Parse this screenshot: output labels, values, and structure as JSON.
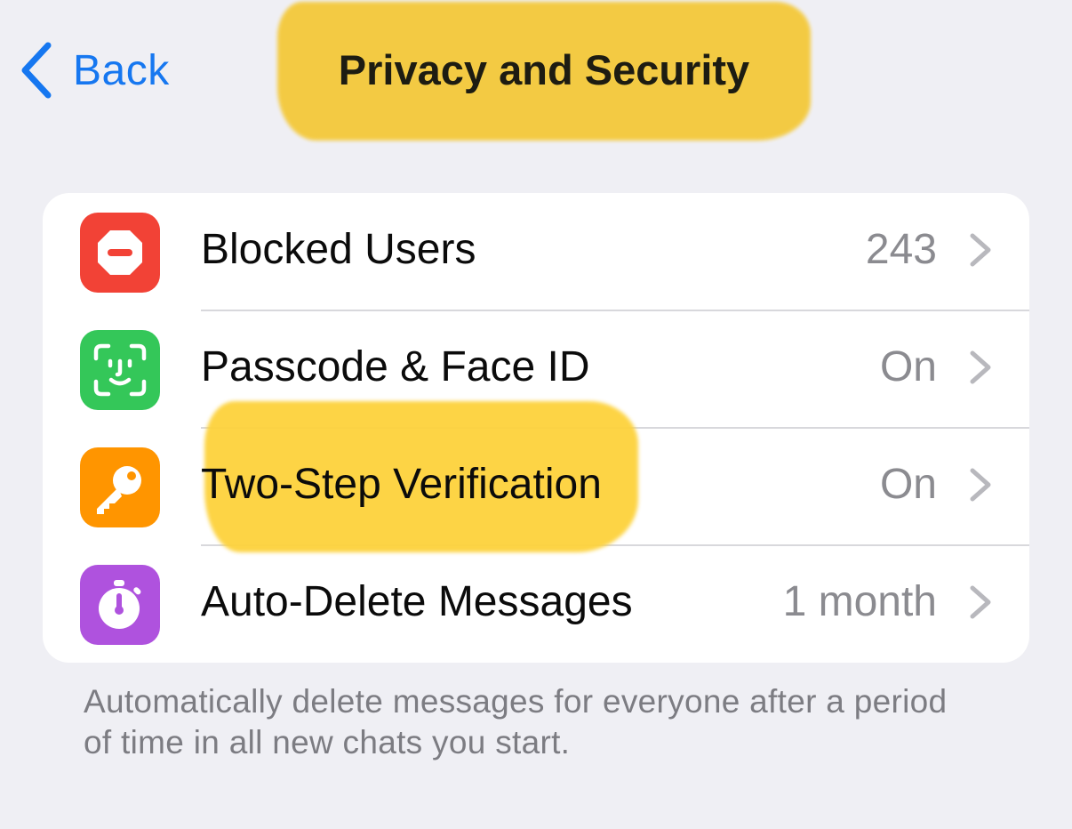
{
  "nav": {
    "back_label": "Back",
    "title": "Privacy and Security"
  },
  "settings": {
    "rows": [
      {
        "label": "Blocked Users",
        "value": "243",
        "icon": "blocked-icon",
        "icon_color": "#f24236"
      },
      {
        "label": "Passcode & Face ID",
        "value": "On",
        "icon": "face-id-icon",
        "icon_color": "#34c759"
      },
      {
        "label": "Two-Step Verification",
        "value": "On",
        "icon": "key-icon",
        "icon_color": "#ff9500"
      },
      {
        "label": "Auto-Delete Messages",
        "value": "1 month",
        "icon": "timer-icon",
        "icon_color": "#af52de"
      }
    ]
  },
  "footer": {
    "note": "Automatically delete messages for everyone after a period of time in all new chats you start."
  },
  "colors": {
    "accent": "#1677f0",
    "highlight": "#f4c93a",
    "background": "#efeff4"
  }
}
